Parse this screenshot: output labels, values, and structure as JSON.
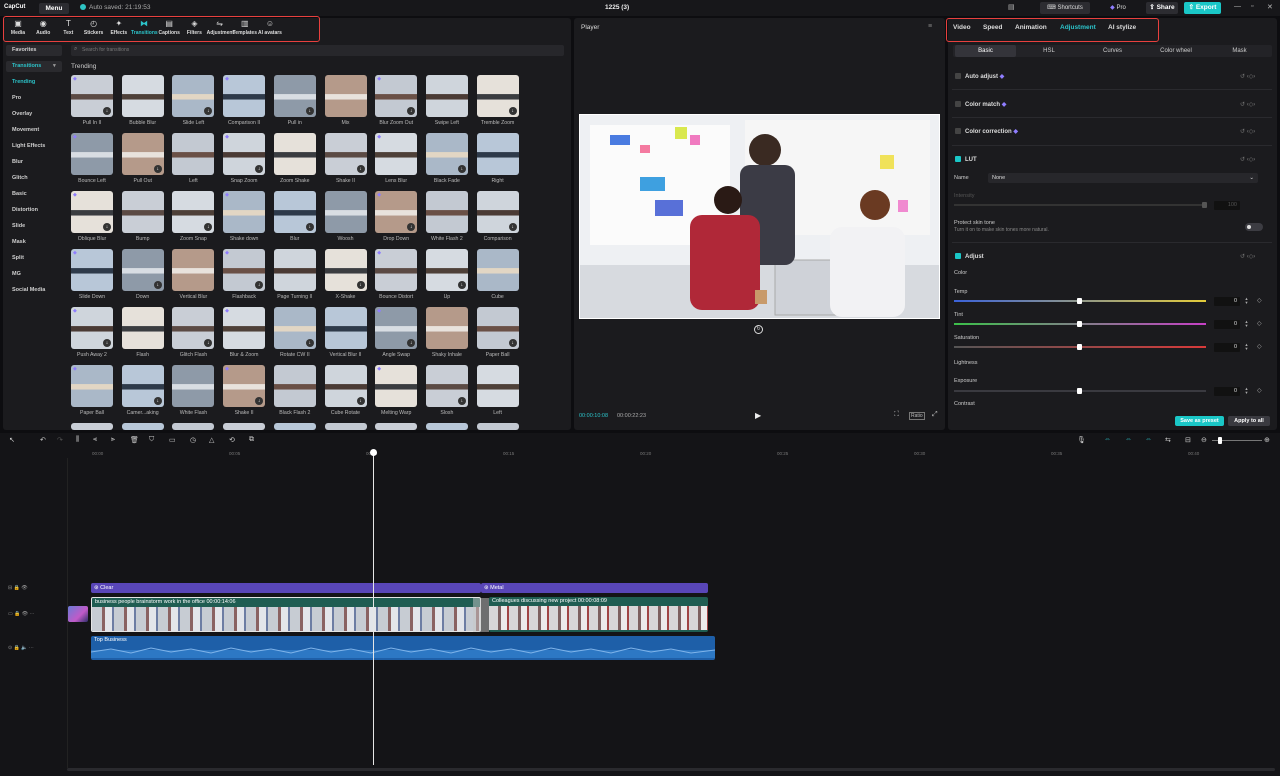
{
  "app": {
    "logo": "CapCut",
    "menu": "Menu",
    "autosave": "Auto saved: 21:19:53",
    "title": "1225 (3)",
    "shortcuts": "Shortcuts",
    "pro": "Pro",
    "share": "Share",
    "export": "Export",
    "accent": "#1ac7c7",
    "highlight": "#e8403e"
  },
  "toolbar": [
    {
      "label": "Media",
      "icon": "media-icon"
    },
    {
      "label": "Audio",
      "icon": "audio-icon"
    },
    {
      "label": "Text",
      "icon": "text-icon"
    },
    {
      "label": "Stickers",
      "icon": "stickers-icon"
    },
    {
      "label": "Effects",
      "icon": "effects-icon"
    },
    {
      "label": "Transitions",
      "icon": "transitions-icon",
      "active": true
    },
    {
      "label": "Captions",
      "icon": "captions-icon"
    },
    {
      "label": "Filters",
      "icon": "filters-icon"
    },
    {
      "label": "Adjustment",
      "icon": "adjustment-icon"
    },
    {
      "label": "Templates",
      "icon": "templates-icon"
    },
    {
      "label": "AI avatars",
      "icon": "ai-avatars-icon"
    }
  ],
  "sidebar": {
    "favorites": "Favorites",
    "transitions": "Transitions",
    "items": [
      "Trending",
      "Pro",
      "Overlay",
      "Movement",
      "Light Effects",
      "Blur",
      "Glitch",
      "Basic",
      "Distortion",
      "Slide",
      "Mask",
      "Split",
      "MG",
      "Social Media"
    ]
  },
  "search": {
    "placeholder": "Search for transitions"
  },
  "section_title": "Trending",
  "tiles": [
    "Pull In II",
    "Bubble Blur",
    "Slide Left",
    "Comparison II",
    "Pull in",
    "Mix",
    "Blur Zoom Out",
    "Swipe Left",
    "Tremble Zoom",
    "Bounce Left",
    "Pull Out",
    "Left",
    "Snap Zoom",
    "Zoom Shake",
    "Shake II",
    "Lens Blur",
    "Black Fade",
    "Right",
    "Oblique Blur",
    "Bump",
    "Zoom Snap",
    "Shake down",
    "Blur",
    "Woosh",
    "Drop Down",
    "White Flash 2",
    "Comparison",
    "Slide Down",
    "Down",
    "Vertical Blur",
    "Flashback",
    "Page Turning II",
    "X-Shake",
    "Bounce Distort",
    "Up",
    "Cube",
    "Push Away 2",
    "Flash",
    "Glitch Flash",
    "Blur & Zoom",
    "Rotate CW II",
    "Vertical Blur II",
    "Angle Swap",
    "Shaky Inhale",
    "Paper Ball",
    "Paper Ball",
    "Camer...aking",
    "White Flash",
    "Shake II",
    "Black Flash 2",
    "Cube Rotate",
    "Melting Warp",
    "Slosh",
    "Left"
  ],
  "player": {
    "title": "Player",
    "current": "00:00:10:08",
    "total": "00:00:22:23",
    "ratio": "Ratio"
  },
  "right": {
    "tabs": [
      "Video",
      "Speed",
      "Animation",
      "Adjustment",
      "AI stylize"
    ],
    "subtabs": [
      "Basic",
      "HSL",
      "Curves",
      "Color wheel",
      "Mask"
    ],
    "auto_adjust": "Auto adjust",
    "color_match": "Color match",
    "color_correction": "Color correction",
    "lut": "LUT",
    "name_label": "Name",
    "name_value": "None",
    "intensity": "Intensity",
    "intensity_value": "100",
    "protect": "Protect skin tone",
    "protect_hint": "Turn it on to make skin tones more natural.",
    "adjust": "Adjust",
    "color": "Color",
    "temp": "Temp",
    "tint": "Tint",
    "saturation": "Saturation",
    "lightness": "Lightness",
    "exposure": "Exposure",
    "contrast": "Contrast",
    "temp_value": "0",
    "tint_value": "0",
    "saturation_value": "0",
    "exposure_value": "0",
    "save_preset": "Save as preset",
    "apply_all": "Apply to all"
  },
  "timeline": {
    "ruler": [
      "00:00",
      "00:05",
      "00:10",
      "00:15",
      "00:20",
      "00:25",
      "00:30",
      "00:35",
      "00:40"
    ],
    "effect1": "Clear",
    "effect2": "Metal",
    "clip1": "business people brainstorm work in the office  00:00:14:06",
    "clip2": "Colleagues discussing new project  00:00:08:09",
    "audio": "Top Business"
  }
}
